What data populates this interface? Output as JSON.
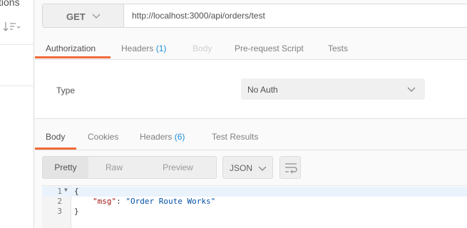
{
  "sidebar": {
    "cut_title": "tions"
  },
  "request": {
    "method": "GET",
    "url": "http://localhost:3000/api/orders/test"
  },
  "request_tabs": [
    {
      "label": "Authorization",
      "count": "",
      "state": "active"
    },
    {
      "label": "Headers",
      "count": "(1)",
      "state": "normal"
    },
    {
      "label": "Body",
      "count": "",
      "state": "disabled"
    },
    {
      "label": "Pre-request Script",
      "count": "",
      "state": "normal"
    },
    {
      "label": "Tests",
      "count": "",
      "state": "normal"
    }
  ],
  "auth": {
    "type_label": "Type",
    "selected": "No Auth"
  },
  "response_tabs": [
    {
      "label": "Body",
      "count": "",
      "state": "active"
    },
    {
      "label": "Cookies",
      "count": "",
      "state": "normal"
    },
    {
      "label": "Headers",
      "count": "(6)",
      "state": "normal"
    },
    {
      "label": "Test Results",
      "count": "",
      "state": "normal"
    }
  ],
  "view_modes": [
    "Pretty",
    "Raw",
    "Preview"
  ],
  "active_view_mode": "Pretty",
  "format": "JSON",
  "code_lines": [
    {
      "number": "1",
      "text": "{"
    },
    {
      "number": "2",
      "key": "\"msg\"",
      "separator": ": ",
      "value": "\"Order Route Works\""
    },
    {
      "number": "3",
      "text": "}"
    }
  ],
  "colors": {
    "accent": "#f26b3a",
    "count_blue": "#1f8dd6"
  },
  "icons": [
    "sort-icon",
    "chevron-down-icon",
    "wrap-lines-icon",
    "fold-arrow-icon"
  ]
}
